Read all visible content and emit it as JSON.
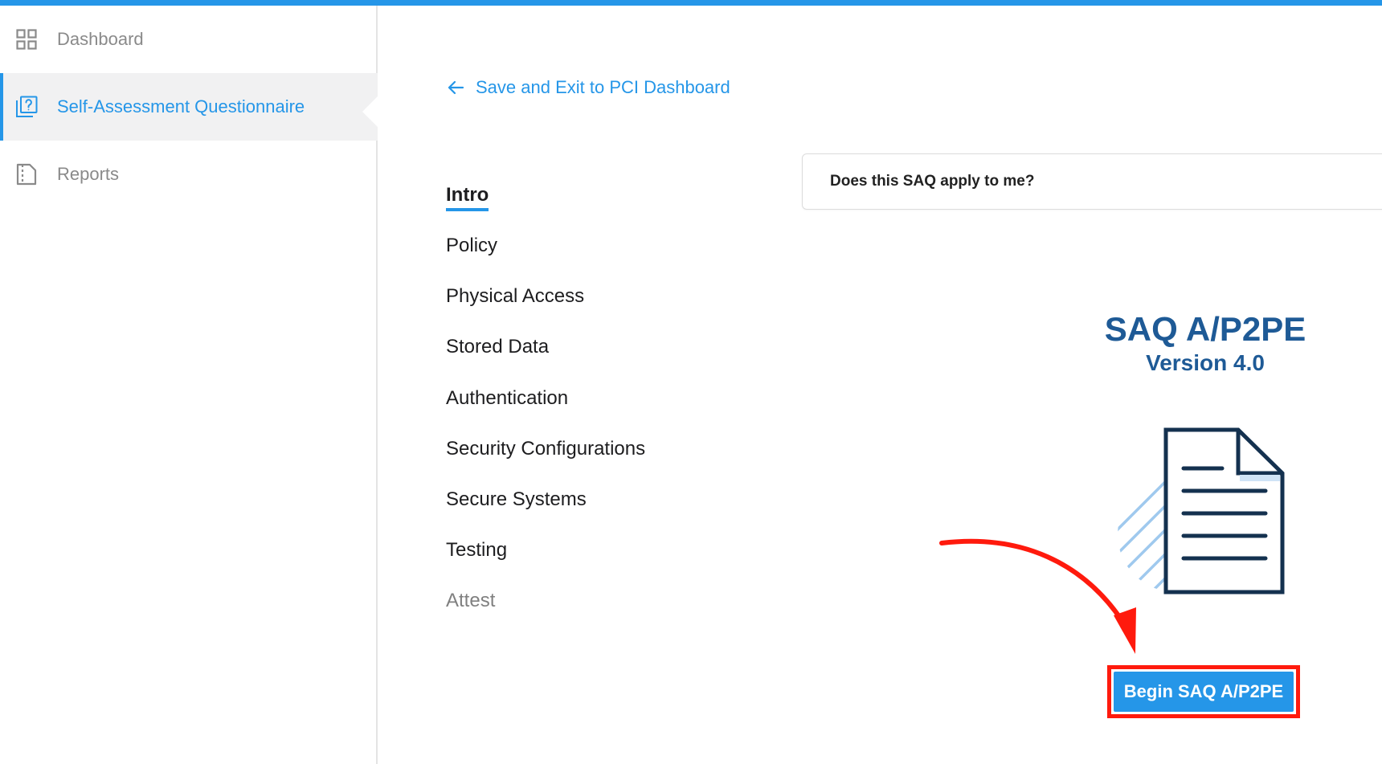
{
  "colors": {
    "accent": "#2596e8",
    "title": "#1e5a96",
    "annotation_red": "#ff1a0d"
  },
  "sidebar": {
    "items": [
      {
        "label": "Dashboard",
        "icon": "grid-icon",
        "active": false
      },
      {
        "label": "Self-Assessment Questionnaire",
        "icon": "questionnaire-icon",
        "active": true
      },
      {
        "label": "Reports",
        "icon": "report-icon",
        "active": false
      }
    ]
  },
  "main": {
    "back_link": {
      "label": "Save and Exit to PCI Dashboard",
      "icon": "arrow-left-icon"
    },
    "steps": [
      {
        "label": "Intro",
        "state": "active"
      },
      {
        "label": "Policy",
        "state": "default"
      },
      {
        "label": "Physical Access",
        "state": "default"
      },
      {
        "label": "Stored Data",
        "state": "default"
      },
      {
        "label": "Authentication",
        "state": "default"
      },
      {
        "label": "Security Configurations",
        "state": "default"
      },
      {
        "label": "Secure Systems",
        "state": "default"
      },
      {
        "label": "Testing",
        "state": "default"
      },
      {
        "label": "Attest",
        "state": "disabled"
      }
    ],
    "faq": {
      "label": "Does this SAQ apply to me?"
    },
    "saq": {
      "title": "SAQ A/P2PE",
      "version": "Version 4.0",
      "illustration": "document-icon",
      "begin_button": "Begin SAQ A/P2PE"
    }
  }
}
